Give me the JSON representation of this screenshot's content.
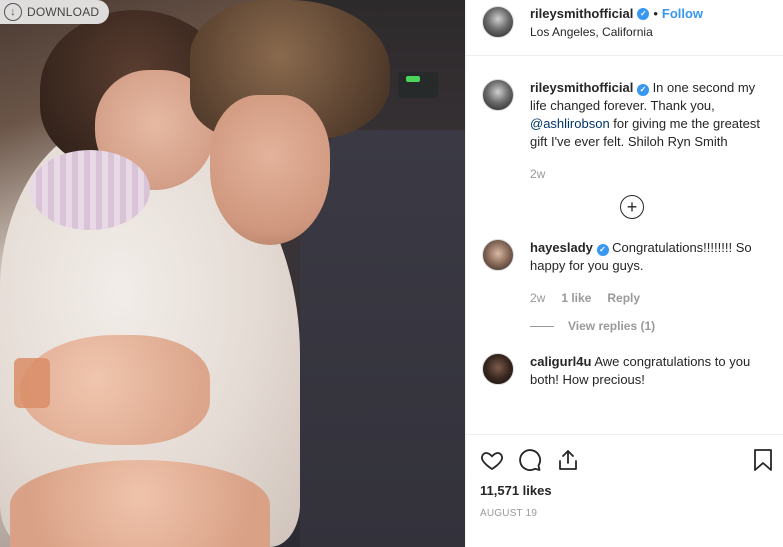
{
  "photo": {
    "download_label": "DOWNLOAD"
  },
  "post_header": {
    "username": "rileysmithofficial",
    "separator": "•",
    "follow_label": "Follow",
    "location": "Los Angeles, California"
  },
  "caption": {
    "username": "rileysmithofficial",
    "text_before": "In one second my life changed forever. Thank you, ",
    "mention": "@ashlirobson",
    "text_after": " for giving me the greatest gift I've ever felt. Shiloh Ryn Smith",
    "time": "2w"
  },
  "comments": [
    {
      "username": "hayeslady",
      "text": "Congratulations!!!!!!!! So happy for you guys.",
      "time": "2w",
      "likes": "1 like",
      "reply_label": "Reply",
      "view_replies": "View replies (1)"
    },
    {
      "username": "caligurl4u",
      "text": "Awe congratulations to you both! How precious!"
    }
  ],
  "actions": {
    "likes": "11,571 likes",
    "date": "AUGUST 19",
    "icons": [
      "heart-icon",
      "comment-icon",
      "share-icon",
      "bookmark-icon"
    ]
  },
  "colors": {
    "accent": "#3897f0",
    "mention": "#003569",
    "muted": "#999999"
  }
}
